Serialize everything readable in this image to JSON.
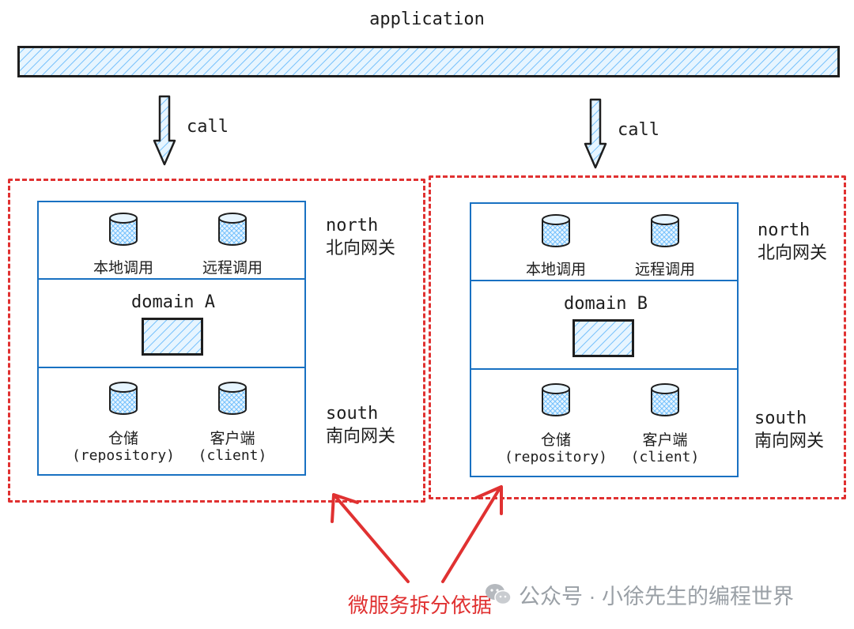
{
  "application": {
    "title": "application"
  },
  "calls": [
    {
      "label": "call"
    },
    {
      "label": "call"
    }
  ],
  "domains": [
    {
      "north": {
        "items": [
          {
            "label": "本地调用",
            "icon": "database-icon"
          },
          {
            "label": "远程调用",
            "icon": "database-icon"
          }
        ]
      },
      "domain": {
        "title": "domain A"
      },
      "south": {
        "items": [
          {
            "label": "仓储",
            "sub": "(repository)",
            "icon": "database-icon"
          },
          {
            "label": "客户端",
            "sub": "(client)",
            "icon": "database-icon"
          }
        ]
      },
      "north_label": {
        "en": "north",
        "zh": "北向网关"
      },
      "south_label": {
        "en": "south",
        "zh": "南向网关"
      }
    },
    {
      "north": {
        "items": [
          {
            "label": "本地调用",
            "icon": "database-icon"
          },
          {
            "label": "远程调用",
            "icon": "database-icon"
          }
        ]
      },
      "domain": {
        "title": "domain B"
      },
      "south": {
        "items": [
          {
            "label": "仓储",
            "sub": "(repository)",
            "icon": "database-icon"
          },
          {
            "label": "客户端",
            "sub": "(client)",
            "icon": "database-icon"
          }
        ]
      },
      "north_label": {
        "en": "north",
        "zh": "北向网关"
      },
      "south_label": {
        "en": "south",
        "zh": "南向网关"
      }
    }
  ],
  "annotation": {
    "text": "微服务拆分依据",
    "color": "#e03131"
  },
  "watermark": {
    "text": "公众号 · 小徐先生的编程世界",
    "icon": "wechat-icon"
  },
  "colors": {
    "layer_border": "#1971c2",
    "hatch": "#a5d8ff",
    "dashed_box": "#e03131"
  }
}
